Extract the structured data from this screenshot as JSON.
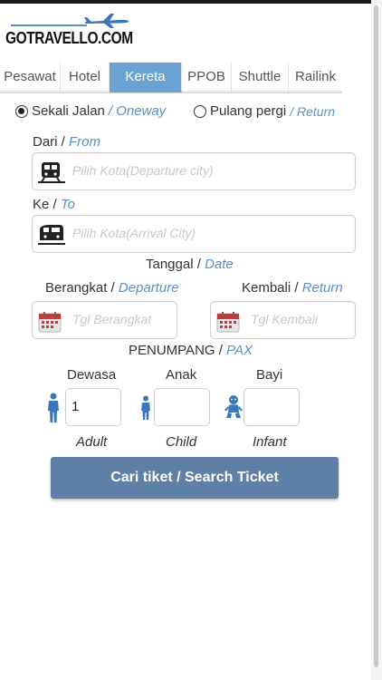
{
  "brand": {
    "name": "GOTRAVELLO.COM"
  },
  "tabs": [
    {
      "label": "Pesawat"
    },
    {
      "label": "Hotel"
    },
    {
      "label": "Kereta"
    },
    {
      "label": "PPOB"
    },
    {
      "label": "Shuttle"
    },
    {
      "label": "Railink"
    }
  ],
  "active_tab": "Kereta",
  "trip_type": {
    "oneway": {
      "label": "Sekali Jalan",
      "en": "/ Oneway",
      "selected": true
    },
    "return": {
      "label": "Pulang pergi",
      "en": "/ Return",
      "selected": false
    }
  },
  "from": {
    "label": "Dari /",
    "en": "From",
    "placeholder": "Pilih Kota(Departure city)",
    "icon": "train-icon"
  },
  "to": {
    "label": "Ke /",
    "en": "To",
    "placeholder": "Pilih Kota(Arrival City)",
    "icon": "train-icon"
  },
  "date": {
    "heading": "Tanggal /",
    "heading_en": "Date",
    "depart_label": "Berangkat /",
    "depart_en": "Departure",
    "depart_placeholder": "Tgl Berangkat",
    "return_label": "Kembali /",
    "return_en": "Return",
    "return_placeholder": "Tgl Kembali",
    "icon": "calendar-icon"
  },
  "passengers": {
    "heading": "PENUMPANG /",
    "heading_en": "PAX",
    "adult": {
      "label": "Dewasa",
      "en": "Adult",
      "value": "1",
      "icon": "adult-person-icon"
    },
    "child": {
      "label": "Anak",
      "en": "Child",
      "value": "",
      "icon": "child-person-icon"
    },
    "infant": {
      "label": "Bayi",
      "en": "Infant",
      "value": "",
      "icon": "baby-icon"
    }
  },
  "search_button": {
    "label": "Cari tiket / Search Ticket"
  },
  "colors": {
    "accent": "#6aa3d3",
    "button": "#5e7fa6",
    "english_text": "#5b8fc9",
    "icon": "#3a76b8"
  }
}
